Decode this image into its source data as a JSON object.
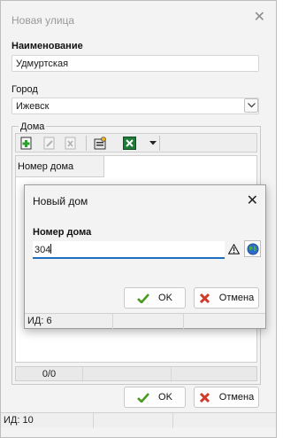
{
  "main_window": {
    "title": "Новая улица",
    "name_label": "Наименование",
    "name_value": "Удмуртская",
    "city_label": "Город",
    "city_value": "Ижевск",
    "houses_group_label": "Дома",
    "grid_column": "Номер дома",
    "counter": "0/0",
    "ok_label": "OK",
    "cancel_label": "Отмена",
    "status_id": "ИД: 10"
  },
  "dialog": {
    "title": "Новый дом",
    "field_label": "Номер дома",
    "field_value": "304",
    "ok_label": "OK",
    "cancel_label": "Отмена",
    "status_id": "ИД: 6"
  },
  "icons": {
    "add": "add-icon",
    "edit": "edit-icon",
    "delete": "delete-icon",
    "properties": "properties-icon",
    "excel": "excel-icon",
    "dropdown": "dropdown-arrow-icon",
    "warning": "warning-icon",
    "globe": "globe-icon"
  },
  "colors": {
    "accent": "#1f6fbf",
    "ok_check": "#4a9a1f",
    "cancel_x": "#d03a2a"
  }
}
